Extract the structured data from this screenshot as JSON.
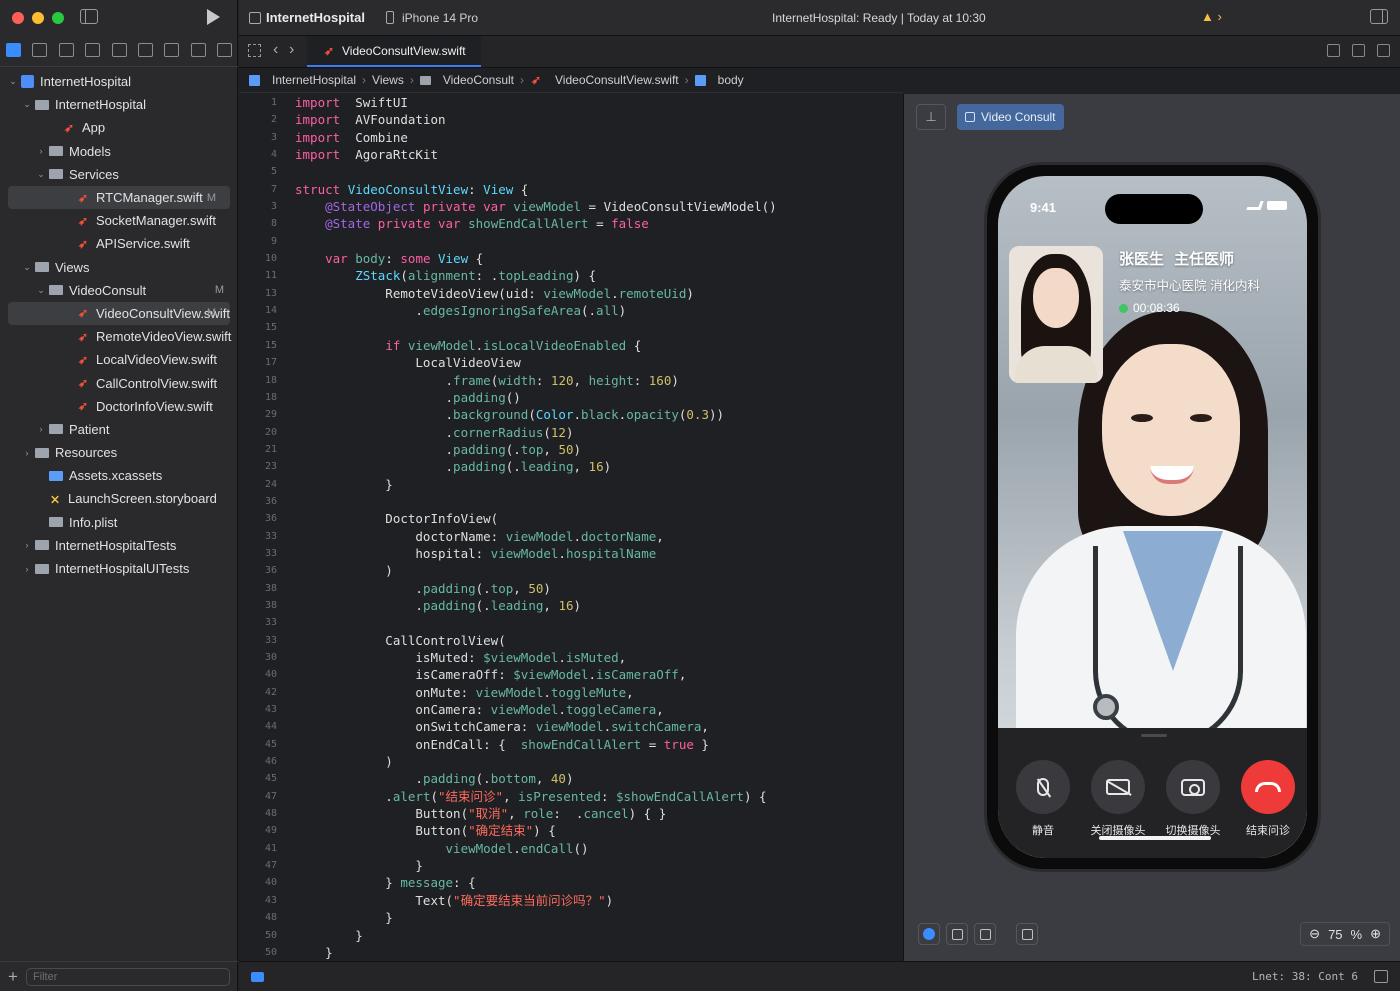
{
  "toolbar": {
    "scheme": "InternetHospital",
    "device": "iPhone 14 Pro",
    "status": "InternetHospital: Ready | Today at 10:30",
    "warning_glyph": "▲ ›"
  },
  "tabs": {
    "active": "VideoConsultView.swift"
  },
  "breadcrumb": [
    "InternetHospital",
    "Views",
    "VideoConsult",
    "VideoConsultView.swift",
    "body"
  ],
  "navigator": {
    "rows": [
      {
        "label": "InternetHospital",
        "kind": "project",
        "indent": 0,
        "chev": "⌄"
      },
      {
        "label": "InternetHospital",
        "kind": "folder",
        "indent": 1,
        "chev": "⌄"
      },
      {
        "label": "App",
        "kind": "swift",
        "indent": 3,
        "chev": ""
      },
      {
        "label": "Models",
        "kind": "folder",
        "indent": 2,
        "chev": "›"
      },
      {
        "label": "Services",
        "kind": "folder",
        "indent": 2,
        "chev": "⌄"
      },
      {
        "label": "RTCManager.swift",
        "kind": "swift",
        "indent": 4,
        "chev": "",
        "badge": "M",
        "selected": true
      },
      {
        "label": "SocketManager.swift",
        "kind": "swift",
        "indent": 4,
        "chev": ""
      },
      {
        "label": "APIService.swift",
        "kind": "swift",
        "indent": 4,
        "chev": ""
      },
      {
        "label": "Views",
        "kind": "folder",
        "indent": 1,
        "chev": "⌄"
      },
      {
        "label": "VideoConsult",
        "kind": "folder",
        "indent": 2,
        "chev": "⌄",
        "badge": "M"
      },
      {
        "label": "VideoConsultView.swift",
        "kind": "swift",
        "indent": 4,
        "chev": "",
        "badge": "M",
        "selected": true
      },
      {
        "label": "RemoteVideoView.swift",
        "kind": "swift",
        "indent": 4,
        "chev": ""
      },
      {
        "label": "LocalVideoView.swift",
        "kind": "swift",
        "indent": 4,
        "chev": ""
      },
      {
        "label": "CallControlView.swift",
        "kind": "swift",
        "indent": 4,
        "chev": ""
      },
      {
        "label": "DoctorInfoView.swift",
        "kind": "swift",
        "indent": 4,
        "chev": ""
      },
      {
        "label": "Patient",
        "kind": "folder",
        "indent": 2,
        "chev": "›"
      },
      {
        "label": "Resources",
        "kind": "folder",
        "indent": 1,
        "chev": "›"
      },
      {
        "label": "Assets.xcassets",
        "kind": "assets",
        "indent": 2,
        "chev": ""
      },
      {
        "label": "LaunchScreen.storyboard",
        "kind": "storyboard",
        "indent": 2,
        "chev": ""
      },
      {
        "label": "Info.plist",
        "kind": "plist",
        "indent": 2,
        "chev": ""
      },
      {
        "label": "InternetHospitalTests",
        "kind": "folder",
        "indent": 1,
        "chev": "›"
      },
      {
        "label": "InternetHospitalUITests",
        "kind": "folder",
        "indent": 1,
        "chev": "›"
      }
    ],
    "filter_placeholder": "Filter",
    "add_glyph": "+"
  },
  "editor": {
    "line_numbers": [
      "1",
      "2",
      "3",
      "4",
      "5",
      "7",
      "3",
      "8",
      "9",
      "10",
      "11",
      "13",
      "14",
      "15",
      "15",
      "17",
      "18",
      "18",
      "29",
      "20",
      "21",
      "23",
      "24",
      "36",
      "36",
      "33",
      "33",
      "36",
      "38",
      "38",
      "33",
      "33",
      "30",
      "40",
      "42",
      "43",
      "44",
      "45",
      "46",
      "45",
      "47",
      "48",
      "49",
      "41",
      "47",
      "40",
      "43",
      "48",
      "50",
      "50"
    ],
    "lines": [
      [
        [
          "kw",
          "import"
        ],
        [
          "",
          "  SwiftUI"
        ]
      ],
      [
        [
          "kw",
          "import"
        ],
        [
          "",
          "  AVFoundation"
        ]
      ],
      [
        [
          "kw",
          "import"
        ],
        [
          "",
          "  Combine"
        ]
      ],
      [
        [
          "kw",
          "import"
        ],
        [
          "",
          "  AgoraRtcKit"
        ]
      ],
      [
        [
          "",
          ""
        ]
      ],
      [
        [
          "kw",
          "struct"
        ],
        [
          "",
          " "
        ],
        [
          "ty",
          "VideoConsultView"
        ],
        [
          "",
          ": "
        ],
        [
          "ty",
          "View"
        ],
        [
          "",
          " {"
        ]
      ],
      [
        [
          "",
          "    "
        ],
        [
          "pr",
          "@StateObject"
        ],
        [
          "",
          " "
        ],
        [
          "kw",
          "private var"
        ],
        [
          "",
          " "
        ],
        [
          "fn",
          "viewModel"
        ],
        [
          "",
          " = VideoConsultViewModel()"
        ]
      ],
      [
        [
          "",
          "    "
        ],
        [
          "pr",
          "@State"
        ],
        [
          "",
          " "
        ],
        [
          "kw",
          "private var"
        ],
        [
          "",
          " "
        ],
        [
          "fn",
          "showEndCallAlert"
        ],
        [
          "",
          " = "
        ],
        [
          "kw",
          "false"
        ]
      ],
      [
        [
          "",
          ""
        ]
      ],
      [
        [
          "",
          "    "
        ],
        [
          "kw",
          "var"
        ],
        [
          "",
          " "
        ],
        [
          "fn",
          "body"
        ],
        [
          "",
          ": "
        ],
        [
          "kw",
          "some"
        ],
        [
          "",
          " "
        ],
        [
          "ty",
          "View"
        ],
        [
          "",
          " {"
        ]
      ],
      [
        [
          "",
          "        "
        ],
        [
          "ty",
          "ZStack"
        ],
        [
          "",
          "("
        ],
        [
          "fn",
          "alignment"
        ],
        [
          "",
          ": ."
        ],
        [
          "fn",
          "topLeading"
        ],
        [
          "",
          ") {"
        ]
      ],
      [
        [
          "",
          "            RemoteVideoView(uid: "
        ],
        [
          "fn",
          "viewModel"
        ],
        [
          "",
          "."
        ],
        [
          "fn",
          "remoteUid"
        ],
        [
          "",
          ")"
        ]
      ],
      [
        [
          "",
          "                ."
        ],
        [
          "fn",
          "edgesIgnoringSafeArea"
        ],
        [
          "",
          "(."
        ],
        [
          "fn",
          "all"
        ],
        [
          "",
          ")"
        ]
      ],
      [
        [
          "",
          ""
        ]
      ],
      [
        [
          "",
          "            "
        ],
        [
          "kw",
          "if"
        ],
        [
          "",
          " "
        ],
        [
          "fn",
          "viewModel"
        ],
        [
          "",
          "."
        ],
        [
          "fn",
          "isLocalVideoEnabled"
        ],
        [
          "",
          " {"
        ]
      ],
      [
        [
          "",
          "                LocalVideoView"
        ]
      ],
      [
        [
          "",
          "                    ."
        ],
        [
          "fn",
          "frame"
        ],
        [
          "",
          "("
        ],
        [
          "fn",
          "width"
        ],
        [
          "",
          ": "
        ],
        [
          "nm",
          "120"
        ],
        [
          "",
          ", "
        ],
        [
          "fn",
          "height"
        ],
        [
          "",
          ": "
        ],
        [
          "nm",
          "160"
        ],
        [
          "",
          ")"
        ]
      ],
      [
        [
          "",
          "                    ."
        ],
        [
          "fn",
          "padding"
        ],
        [
          "",
          "()"
        ]
      ],
      [
        [
          "",
          "                    ."
        ],
        [
          "fn",
          "background"
        ],
        [
          "",
          "("
        ],
        [
          "ty",
          "Color"
        ],
        [
          "",
          "."
        ],
        [
          "fn",
          "black"
        ],
        [
          "",
          "."
        ],
        [
          "fn",
          "opacity"
        ],
        [
          "",
          "("
        ],
        [
          "nm",
          "0.3"
        ],
        [
          "",
          "))"
        ]
      ],
      [
        [
          "",
          "                    ."
        ],
        [
          "fn",
          "cornerRadius"
        ],
        [
          "",
          "("
        ],
        [
          "nm",
          "12"
        ],
        [
          "",
          ")"
        ]
      ],
      [
        [
          "",
          "                    ."
        ],
        [
          "fn",
          "padding"
        ],
        [
          "",
          "(."
        ],
        [
          "fn",
          "top"
        ],
        [
          "",
          ", "
        ],
        [
          "nm",
          "50"
        ],
        [
          "",
          ")"
        ]
      ],
      [
        [
          "",
          "                    ."
        ],
        [
          "fn",
          "padding"
        ],
        [
          "",
          "(."
        ],
        [
          "fn",
          "leading"
        ],
        [
          "",
          ", "
        ],
        [
          "nm",
          "16"
        ],
        [
          "",
          ")"
        ]
      ],
      [
        [
          "",
          "            }"
        ]
      ],
      [
        [
          "",
          ""
        ]
      ],
      [
        [
          "",
          "            DoctorInfoView("
        ]
      ],
      [
        [
          "",
          "                doctorName: "
        ],
        [
          "fn",
          "viewModel"
        ],
        [
          "",
          "."
        ],
        [
          "fn",
          "doctorName"
        ],
        [
          "",
          ","
        ]
      ],
      [
        [
          "",
          "                hospital: "
        ],
        [
          "fn",
          "viewModel"
        ],
        [
          "",
          "."
        ],
        [
          "fn",
          "hospitalName"
        ]
      ],
      [
        [
          "",
          "            )"
        ]
      ],
      [
        [
          "",
          "                ."
        ],
        [
          "fn",
          "padding"
        ],
        [
          "",
          "(."
        ],
        [
          "fn",
          "top"
        ],
        [
          "",
          ", "
        ],
        [
          "nm",
          "50"
        ],
        [
          "",
          ")"
        ]
      ],
      [
        [
          "",
          "                ."
        ],
        [
          "fn",
          "padding"
        ],
        [
          "",
          "(."
        ],
        [
          "fn",
          "leading"
        ],
        [
          "",
          ", "
        ],
        [
          "nm",
          "16"
        ],
        [
          "",
          ")"
        ]
      ],
      [
        [
          "",
          ""
        ]
      ],
      [
        [
          "",
          "            CallControlView("
        ]
      ],
      [
        [
          "",
          "                isMuted: "
        ],
        [
          "fn",
          "$viewModel"
        ],
        [
          "",
          "."
        ],
        [
          "fn",
          "isMuted"
        ],
        [
          "",
          ","
        ]
      ],
      [
        [
          "",
          "                isCameraOff: "
        ],
        [
          "fn",
          "$viewModel"
        ],
        [
          "",
          "."
        ],
        [
          "fn",
          "isCameraOff"
        ],
        [
          "",
          ","
        ]
      ],
      [
        [
          "",
          "                onMute: "
        ],
        [
          "fn",
          "viewModel"
        ],
        [
          "",
          "."
        ],
        [
          "fn",
          "toggleMute"
        ],
        [
          "",
          ","
        ]
      ],
      [
        [
          "",
          "                onCamera: "
        ],
        [
          "fn",
          "viewModel"
        ],
        [
          "",
          "."
        ],
        [
          "fn",
          "toggleCamera"
        ],
        [
          "",
          ","
        ]
      ],
      [
        [
          "",
          "                onSwitchCamera: "
        ],
        [
          "fn",
          "viewModel"
        ],
        [
          "",
          "."
        ],
        [
          "fn",
          "switchCamera"
        ],
        [
          "",
          ","
        ]
      ],
      [
        [
          "",
          "                onEndCall: {  "
        ],
        [
          "fn",
          "showEndCallAlert"
        ],
        [
          "",
          " = "
        ],
        [
          "kw",
          "true"
        ],
        [
          "",
          " }"
        ]
      ],
      [
        [
          "",
          "            )"
        ]
      ],
      [
        [
          "",
          "                ."
        ],
        [
          "fn",
          "padding"
        ],
        [
          "",
          "(."
        ],
        [
          "fn",
          "bottom"
        ],
        [
          "",
          ", "
        ],
        [
          "nm",
          "40"
        ],
        [
          "",
          ")"
        ]
      ],
      [
        [
          "",
          "            ."
        ],
        [
          "fn",
          "alert"
        ],
        [
          "",
          "("
        ],
        [
          "st",
          "\"结束问诊\""
        ],
        [
          "",
          ", "
        ],
        [
          "fn",
          "isPresented"
        ],
        [
          "",
          ": "
        ],
        [
          "fn",
          "$showEndCallAlert"
        ],
        [
          "",
          ") {"
        ]
      ],
      [
        [
          "",
          "                Button("
        ],
        [
          "st",
          "\"取消\""
        ],
        [
          "",
          ", "
        ],
        [
          "fn",
          "role"
        ],
        [
          "",
          ":  ."
        ],
        [
          "fn",
          "cancel"
        ],
        [
          "",
          ") { }"
        ]
      ],
      [
        [
          "",
          "                Button("
        ],
        [
          "st",
          "\"确定结束\""
        ],
        [
          "",
          ") {"
        ]
      ],
      [
        [
          "",
          "                    "
        ],
        [
          "fn",
          "viewModel"
        ],
        [
          "",
          "."
        ],
        [
          "fn",
          "endCall"
        ],
        [
          "",
          "()"
        ]
      ],
      [
        [
          "",
          "                }"
        ]
      ],
      [
        [
          "",
          "            } "
        ],
        [
          "fn",
          "message"
        ],
        [
          "",
          ": {"
        ]
      ],
      [
        [
          "",
          "                Text("
        ],
        [
          "st",
          "\"确定要结束当前问诊吗？\""
        ],
        [
          "",
          ")"
        ]
      ],
      [
        [
          "",
          "            }"
        ]
      ],
      [
        [
          "",
          "        }"
        ]
      ],
      [
        [
          "",
          "    }"
        ]
      ]
    ]
  },
  "canvas": {
    "pin_glyph": "⊥",
    "chip_label": "Video Consult",
    "zoom_value": "75",
    "zoom_unit": "%"
  },
  "phone": {
    "time": "9:41",
    "doctor_name": "张医生",
    "doctor_title": "主任医师",
    "hospital": "泰安市中心医院 消化内科",
    "call_timer": "00:08:36",
    "controls": [
      {
        "label": "静音",
        "icon": "mic-off-icon"
      },
      {
        "label": "关闭摄像头",
        "icon": "camera-off-icon"
      },
      {
        "label": "切换摄像头",
        "icon": "switch-camera-icon"
      },
      {
        "label": "结束问诊",
        "icon": "hang-up-icon"
      }
    ]
  },
  "statusbar": {
    "cursor": "Lnet: 38: Cont 6"
  },
  "colors": {
    "accent": "#3b7cf0",
    "end_call": "#ef3a3a",
    "live": "#41c463",
    "swift": "#f05138"
  }
}
